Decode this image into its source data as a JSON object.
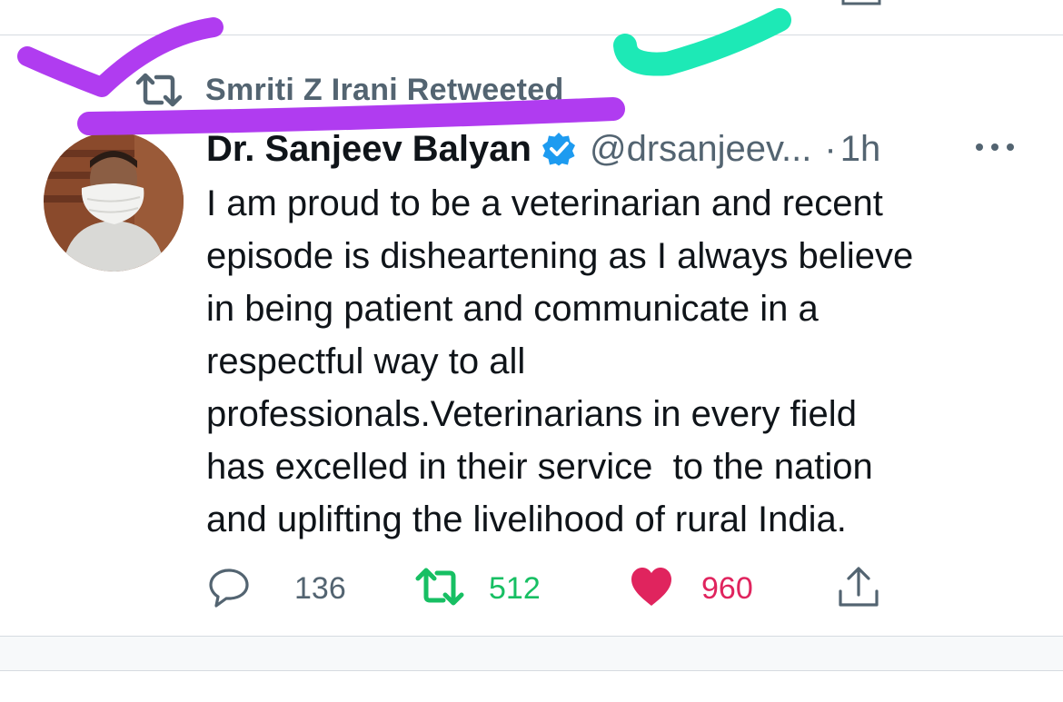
{
  "retweet_context": {
    "label": "Smriti Z Irani Retweeted"
  },
  "tweet": {
    "author_name": "Dr. Sanjeev Balyan",
    "handle": "@drsanjeev...",
    "separator": "·",
    "time": "1h",
    "body_lines": [
      "I am proud to be a veterinarian and recent",
      "episode is disheartening as I always believe",
      "in being patient and communicate in a",
      "respectful way to all",
      "professionals.Veterinarians in every field",
      "has excelled in their service  to the nation",
      "and uplifting the livelihood of rural India."
    ],
    "actions": {
      "replies": "136",
      "retweets": "512",
      "likes": "960"
    }
  },
  "colors": {
    "secondary_text": "#536471",
    "retweet_green": "#17bf63",
    "like_pink": "#e0245e",
    "verified_blue": "#1d9bf0",
    "annotation_purple": "#b03cf0",
    "annotation_teal": "#1de9b6"
  },
  "icons": {
    "retweet_context": "retweet-icon",
    "verified": "verified-badge-icon",
    "more": "more-dots-icon",
    "reply": "reply-bubble-icon",
    "retweet": "retweet-icon",
    "like": "heart-filled-icon",
    "share": "share-upload-icon"
  }
}
